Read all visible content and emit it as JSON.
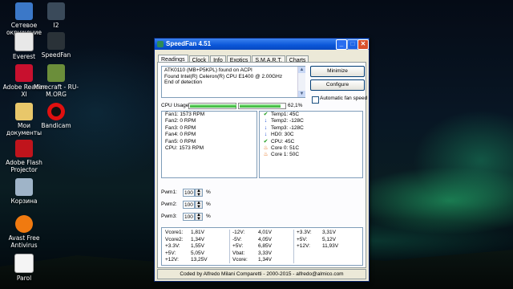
{
  "desktop": {
    "icons": [
      {
        "label": "Сетевое окружение",
        "icon": "network-icon"
      },
      {
        "label": "Everest",
        "icon": "everest-icon"
      },
      {
        "label": "Adobe Reader XI",
        "icon": "pdf-icon"
      },
      {
        "label": "Мои документы",
        "icon": "folder-icon"
      },
      {
        "label": "Adobe Flash Projector",
        "icon": "flash-icon"
      },
      {
        "label": "Корзина",
        "icon": "recycle-bin-icon"
      },
      {
        "label": "Avast Free Antivirus",
        "icon": "avast-icon"
      },
      {
        "label": "Parol",
        "icon": "document-icon"
      },
      {
        "label": "I2",
        "icon": "app-icon"
      },
      {
        "label": "SpeedFan",
        "icon": "speedfan-icon"
      },
      {
        "label": "Minecraft - RU-M.ORG",
        "icon": "minecraft-icon"
      },
      {
        "label": "Bandicam",
        "icon": "bandicam-icon"
      }
    ]
  },
  "window": {
    "title": "SpeedFan 4.51",
    "controls": {
      "minimize": "_",
      "maximize": "□",
      "close": "✕"
    },
    "tabs": [
      "Readings",
      "Clock",
      "Info",
      "Exotics",
      "S.M.A.R.T.",
      "Charts"
    ],
    "active_tab": "Readings",
    "log_lines": [
      "ATK0110 (MB+P5KPL) found on ACPI",
      "Found Intel(R) Celeron(R) CPU E1400 @ 2.00GHz",
      "End of detection"
    ],
    "buttons": {
      "minimize": "Minimize",
      "configure": "Configure"
    },
    "auto_fan_speed": "Automatic fan speed",
    "cpu_usage": {
      "label": "CPU Usage",
      "percent_text": "62,1%",
      "bar1": 1.0,
      "bar2": 0.88
    },
    "fans": [
      "Fan1: 1573 RPM",
      "Fan2: 0 RPM",
      "Fan3: 0 RPM",
      "Fan4: 0 RPM",
      "Fan5: 0 RPM",
      "CPU:  1573 RPM"
    ],
    "temps": [
      {
        "text": "Temp1: 45C",
        "icon": "check-icon"
      },
      {
        "text": "Temp2: -128C",
        "icon": "down-arrow-icon"
      },
      {
        "text": "Temp3: -128C",
        "icon": "down-arrow-icon"
      },
      {
        "text": "HD0:   30C",
        "icon": "down-arrow-icon"
      },
      {
        "text": "CPU:   45C",
        "icon": "check-icon"
      },
      {
        "text": "Core 0: 51C",
        "icon": "flame-icon"
      },
      {
        "text": "Core 1: 50C",
        "icon": "flame-icon"
      }
    ],
    "pwm": [
      {
        "label": "Pwm1:",
        "value": "100",
        "unit": "%"
      },
      {
        "label": "Pwm2:",
        "value": "100",
        "unit": "%"
      },
      {
        "label": "Pwm3:",
        "value": "100",
        "unit": "%"
      }
    ],
    "voltages": [
      [
        [
          "Vcore1:",
          "1,81V"
        ],
        [
          "Vcore2:",
          "1,34V"
        ],
        [
          "+3.3V:",
          "1,55V"
        ],
        [
          "+5V:",
          "5,05V"
        ],
        [
          "+12V:",
          "13,25V"
        ]
      ],
      [
        [
          "-12V:",
          "4,01V"
        ],
        [
          "-5V:",
          "4,05V"
        ],
        [
          "+5V:",
          "6,85V"
        ],
        [
          "Vbat:",
          "3,33V"
        ],
        [
          "Vcore:",
          "1,34V"
        ]
      ],
      [
        [
          "+3.3V:",
          "3,31V"
        ],
        [
          "+5V:",
          "5,12V"
        ],
        [
          "+12V:",
          "11,93V"
        ]
      ]
    ],
    "status": "Coded by Alfredo Milani Comparetti - 2000-2015 - alfredo@almico.com"
  }
}
